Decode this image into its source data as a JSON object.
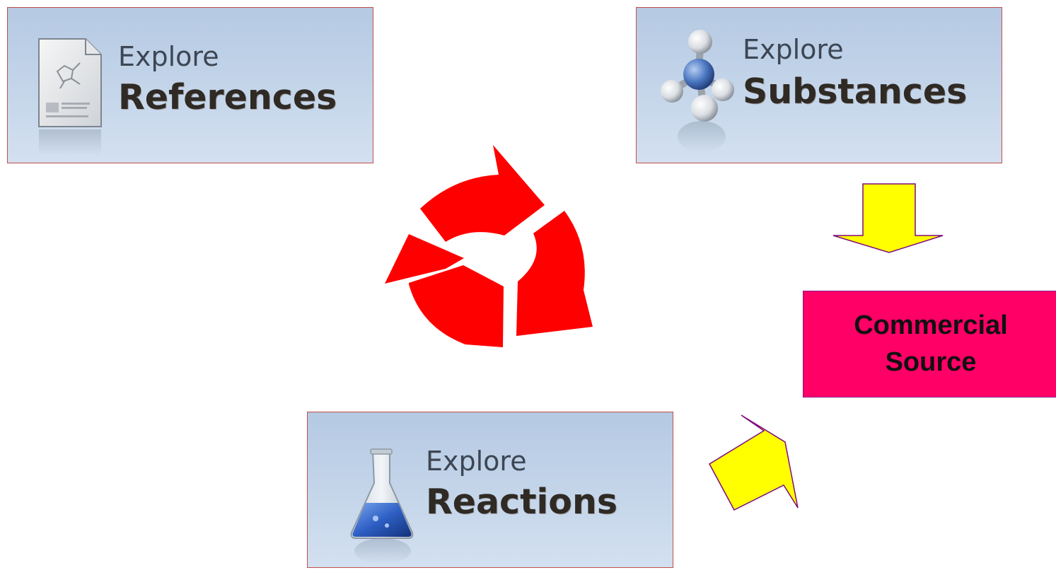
{
  "tiles": {
    "references": {
      "small": "Explore",
      "big": "References",
      "icon": "document-icon"
    },
    "substances": {
      "small": "Explore",
      "big": "Substances",
      "icon": "molecule-icon"
    },
    "reactions": {
      "small": "Explore",
      "big": "Reactions",
      "icon": "flask-icon"
    }
  },
  "commercial_source": {
    "line1": "Commercial",
    "line2": "Source"
  },
  "colors": {
    "tile_border": "#c0504d",
    "tile_gradient_top": "#b5c9e3",
    "tile_gradient_bottom": "#d3e0f0",
    "cycle_arrows": "#ff0000",
    "pointer_arrows_fill": "#ffff00",
    "pointer_arrows_stroke": "#7f0a7f",
    "commercial_fill": "#ff0066"
  },
  "icons": {
    "cycle": "cycle-arrows-icon",
    "down_arrow": "down-arrow-icon",
    "diagonal_arrow": "up-right-arrow-icon"
  }
}
